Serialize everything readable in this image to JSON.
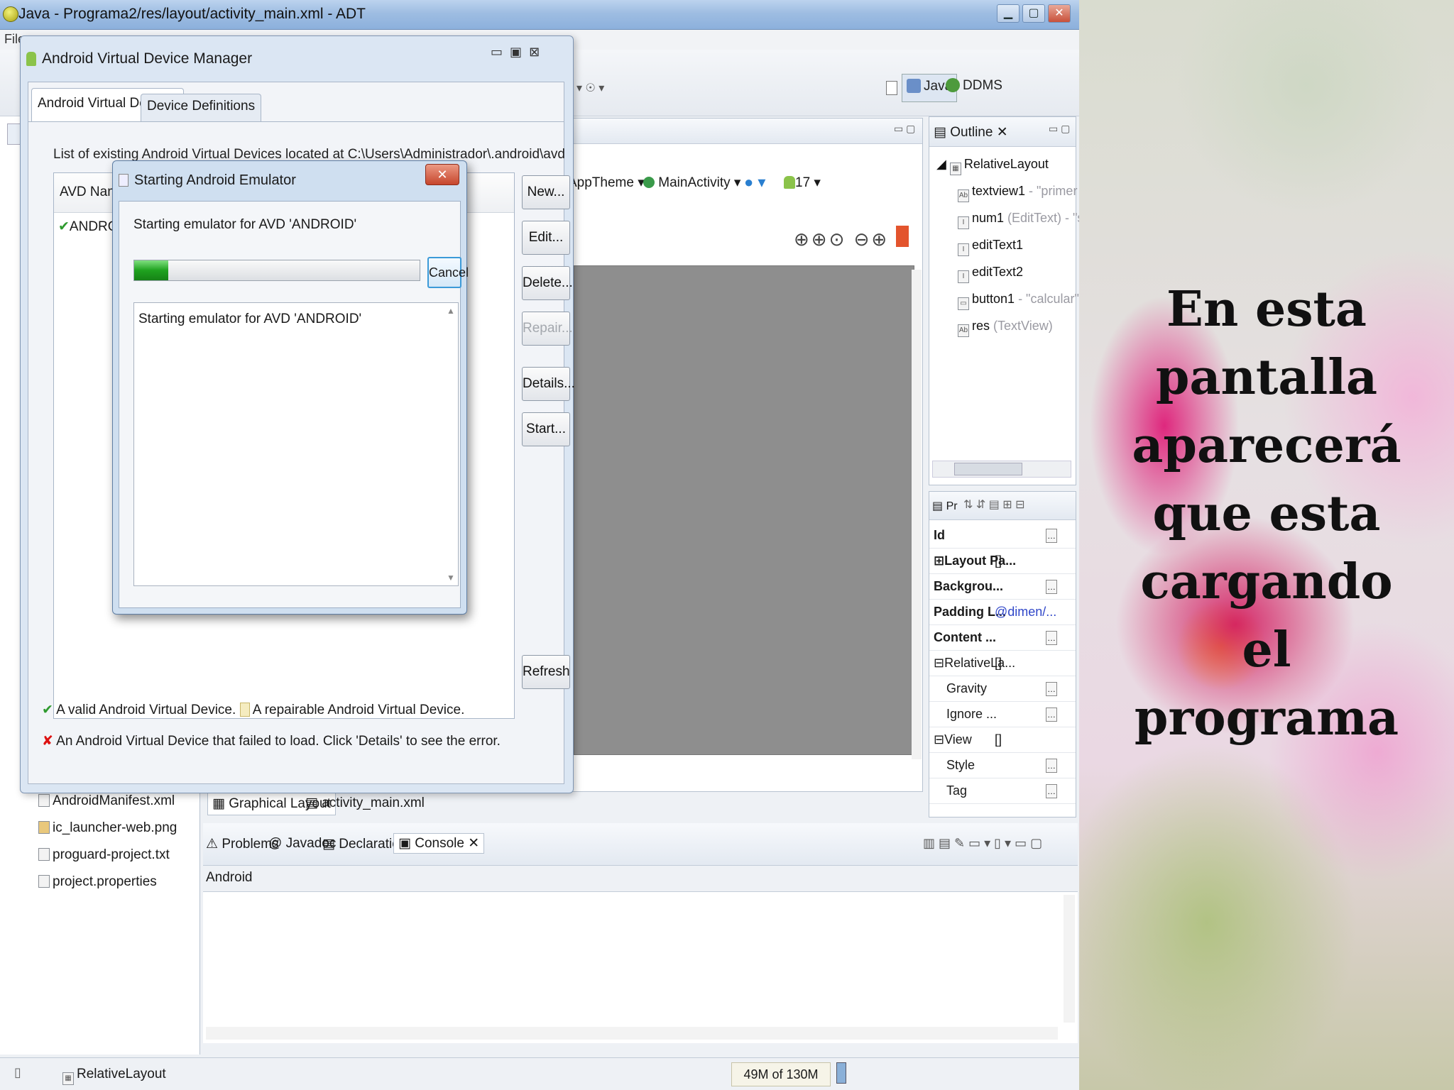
{
  "adt": {
    "title": "Java - Programa2/res/layout/activity_main.xml - ADT",
    "menu_first": "File",
    "perspectives": [
      "Java",
      "DDMS"
    ],
    "editor_toolbar": {
      "theme": "AppTheme",
      "activity": "MainActivity",
      "api": "17"
    },
    "outline": {
      "tab_label": "Outline",
      "items": [
        {
          "label": "RelativeLayout",
          "note": ""
        },
        {
          "label": "textview1",
          "note": " - \"primer nu"
        },
        {
          "label": "num1",
          "note": " (EditText) - \"seg"
        },
        {
          "label": "editText1",
          "note": ""
        },
        {
          "label": "editText2",
          "note": ""
        },
        {
          "label": "button1",
          "note": " - \"calcular\""
        },
        {
          "label": "res",
          "note": " (TextView)"
        }
      ]
    },
    "properties": [
      {
        "key": "Id",
        "value": "",
        "expander": ""
      },
      {
        "key": "Layout Pa...",
        "value": "[]",
        "expander": "⊞"
      },
      {
        "key": "Backgrou...",
        "value": "",
        "expander": ""
      },
      {
        "key": "Padding L...",
        "value": "@dimen/...",
        "expander": ""
      },
      {
        "key": "Content ...",
        "value": "",
        "expander": ""
      },
      {
        "key": "RelativeLa...",
        "value": "[]",
        "expander": "⊟"
      },
      {
        "key": "Gravity",
        "value": "",
        "expander": ""
      },
      {
        "key": "Ignore ...",
        "value": "",
        "expander": ""
      },
      {
        "key": "View",
        "value": "[]",
        "expander": "⊟"
      },
      {
        "key": "Style",
        "value": "",
        "expander": ""
      },
      {
        "key": "Tag",
        "value": "",
        "expander": ""
      }
    ],
    "editor_tabs": [
      "Graphical Layout",
      "activity_main.xml"
    ],
    "package_files": [
      "AndroidManifest.xml",
      "ic_launcher-web.png",
      "proguard-project.txt",
      "project.properties"
    ],
    "console_tabs": [
      "Problems",
      "Javadoc",
      "Declaration",
      "Console"
    ],
    "console_label": "Android",
    "status": {
      "selection": "RelativeLayout",
      "heap": "49M of 130M"
    }
  },
  "avd_manager": {
    "title": "Android Virtual Device Manager",
    "tabs": [
      "Android Virtual Devices",
      "Device Definitions"
    ],
    "list_label": "List of existing Android Virtual Devices located at C:\\Users\\Administrador\\.android\\avd",
    "column_avd_name": "AVD Name",
    "row_name": "ANDROID",
    "buttons": [
      "New...",
      "Edit...",
      "Delete...",
      "Repair...",
      "Details...",
      "Start...",
      "Refresh"
    ],
    "legend_valid": "A valid Android Virtual Device.",
    "legend_repairable": "A repairable Android Virtual Device.",
    "legend_failed": "An Android Virtual Device that failed to load. Click 'Details' to see the error."
  },
  "emulator_dialog": {
    "title": "Starting Android Emulator",
    "message": "Starting emulator for AVD 'ANDROID'",
    "progress": 0.12,
    "cancel": "Cancel",
    "log": "Starting emulator for AVD 'ANDROID'"
  },
  "slide": {
    "caption_lines": [
      "En esta",
      "pantalla",
      "aparecerá",
      "que esta",
      "cargando",
      "el",
      "programa"
    ]
  }
}
